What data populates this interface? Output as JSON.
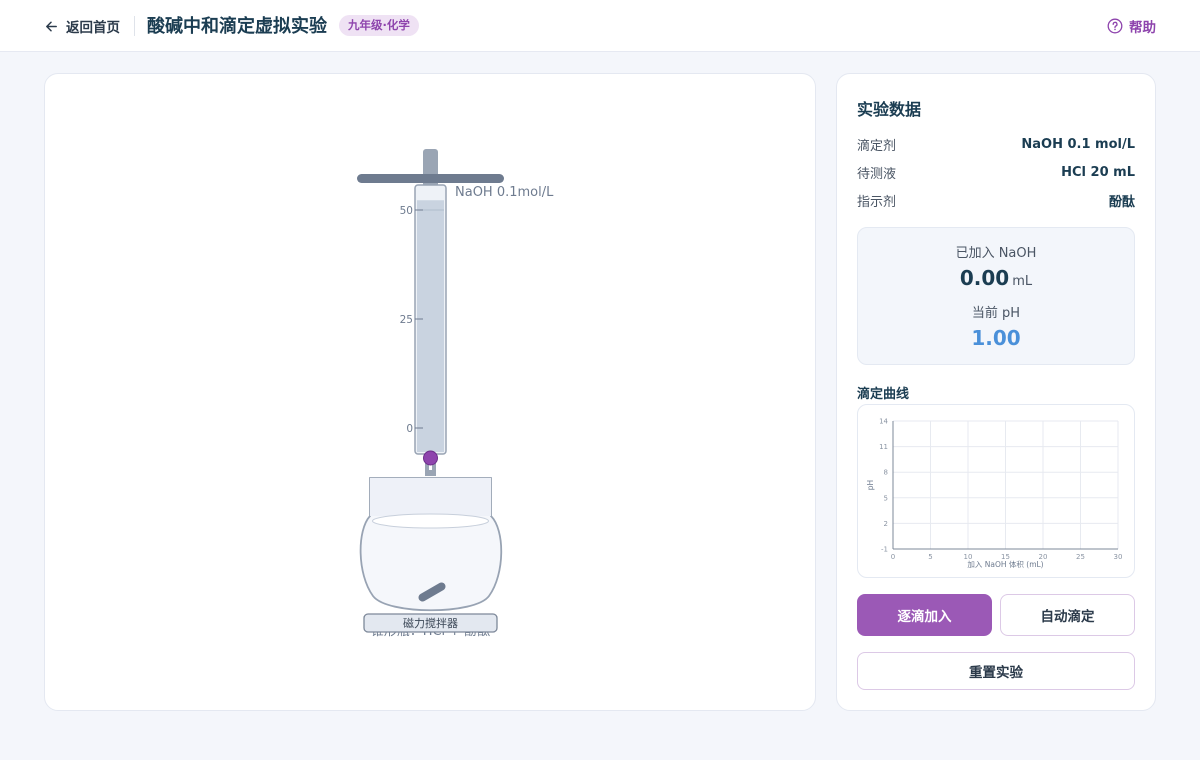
{
  "header": {
    "back_label": "返回首页",
    "title": "酸碱中和滴定虚拟实验",
    "badge": "九年级·化学",
    "help_label": "帮助"
  },
  "apparatus": {
    "burette_label": "NaOH 0.1mol/L",
    "scale": [
      "50",
      "25",
      "0"
    ],
    "beaker_caption": "锥形瓶：HCl + 酚酞",
    "stirrer_label": "磁力搅拌器",
    "burette_fill": 0.95
  },
  "sidebar": {
    "title": "实验数据",
    "rows": [
      {
        "label": "滴定剂",
        "value": "NaOH 0.1 mol/L"
      },
      {
        "label": "待测液",
        "value": "HCl 20 mL"
      },
      {
        "label": "指示剂",
        "value": "酚酞"
      }
    ],
    "readout": {
      "added_label": "已加入 NaOH",
      "added_value": "0.00",
      "added_unit": "mL",
      "ph_label": "当前 pH",
      "ph_value": "1.00"
    },
    "curve_title": "滴定曲线",
    "buttons": {
      "dropwise": "逐滴加入",
      "auto": "自动滴定",
      "reset": "重置实验"
    }
  },
  "chart_data": {
    "type": "line",
    "title": "滴定曲线",
    "xlabel": "加入 NaOH 体积 (mL)",
    "ylabel": "pH",
    "x_ticks": [
      "0",
      "5",
      "10",
      "15",
      "20",
      "25",
      "30"
    ],
    "y_ticks": [
      "14",
      "11",
      "8",
      "5",
      "2",
      "-1"
    ],
    "xlim": [
      0,
      30
    ],
    "ylim": [
      -1,
      14
    ],
    "grid": true,
    "series": [
      {
        "x": [],
        "y": []
      }
    ]
  },
  "colors": {
    "accent": "#9b59b6",
    "ph_value": "#4a90d9",
    "title": "#1b3d52"
  }
}
